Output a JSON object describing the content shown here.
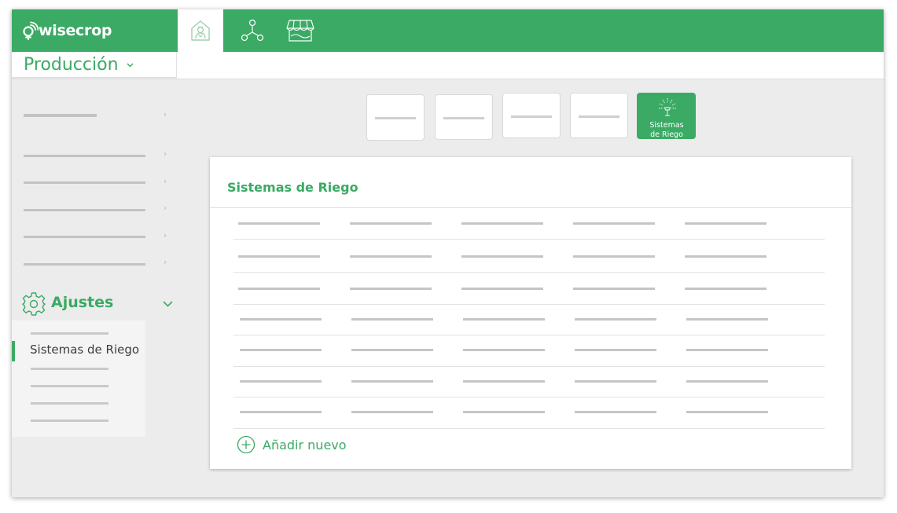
{
  "app": {
    "brand": "wisecrop"
  },
  "nav": {
    "tabs": [
      {
        "icon": "farmer-icon",
        "active": true
      },
      {
        "icon": "network-icon",
        "active": false
      },
      {
        "icon": "market-stall-icon",
        "active": false
      }
    ]
  },
  "section": {
    "title": "Producción"
  },
  "sidebar": {
    "chevron": "›",
    "settings_label": "Ajustes",
    "settings_icon": "gear-icon",
    "active_subitem": "Sistemas de Riego"
  },
  "categories": {
    "active_label_line1": "Sistemas",
    "active_label_line2": "de Riego",
    "active_icon": "sprinkler-icon"
  },
  "main": {
    "title": "Sistemas de Riego",
    "add_label": "Añadir nuevo"
  },
  "colors": {
    "brand_green": "#3aaa64",
    "background": "#ececec",
    "placeholder_gray": "#c5c5c5"
  }
}
